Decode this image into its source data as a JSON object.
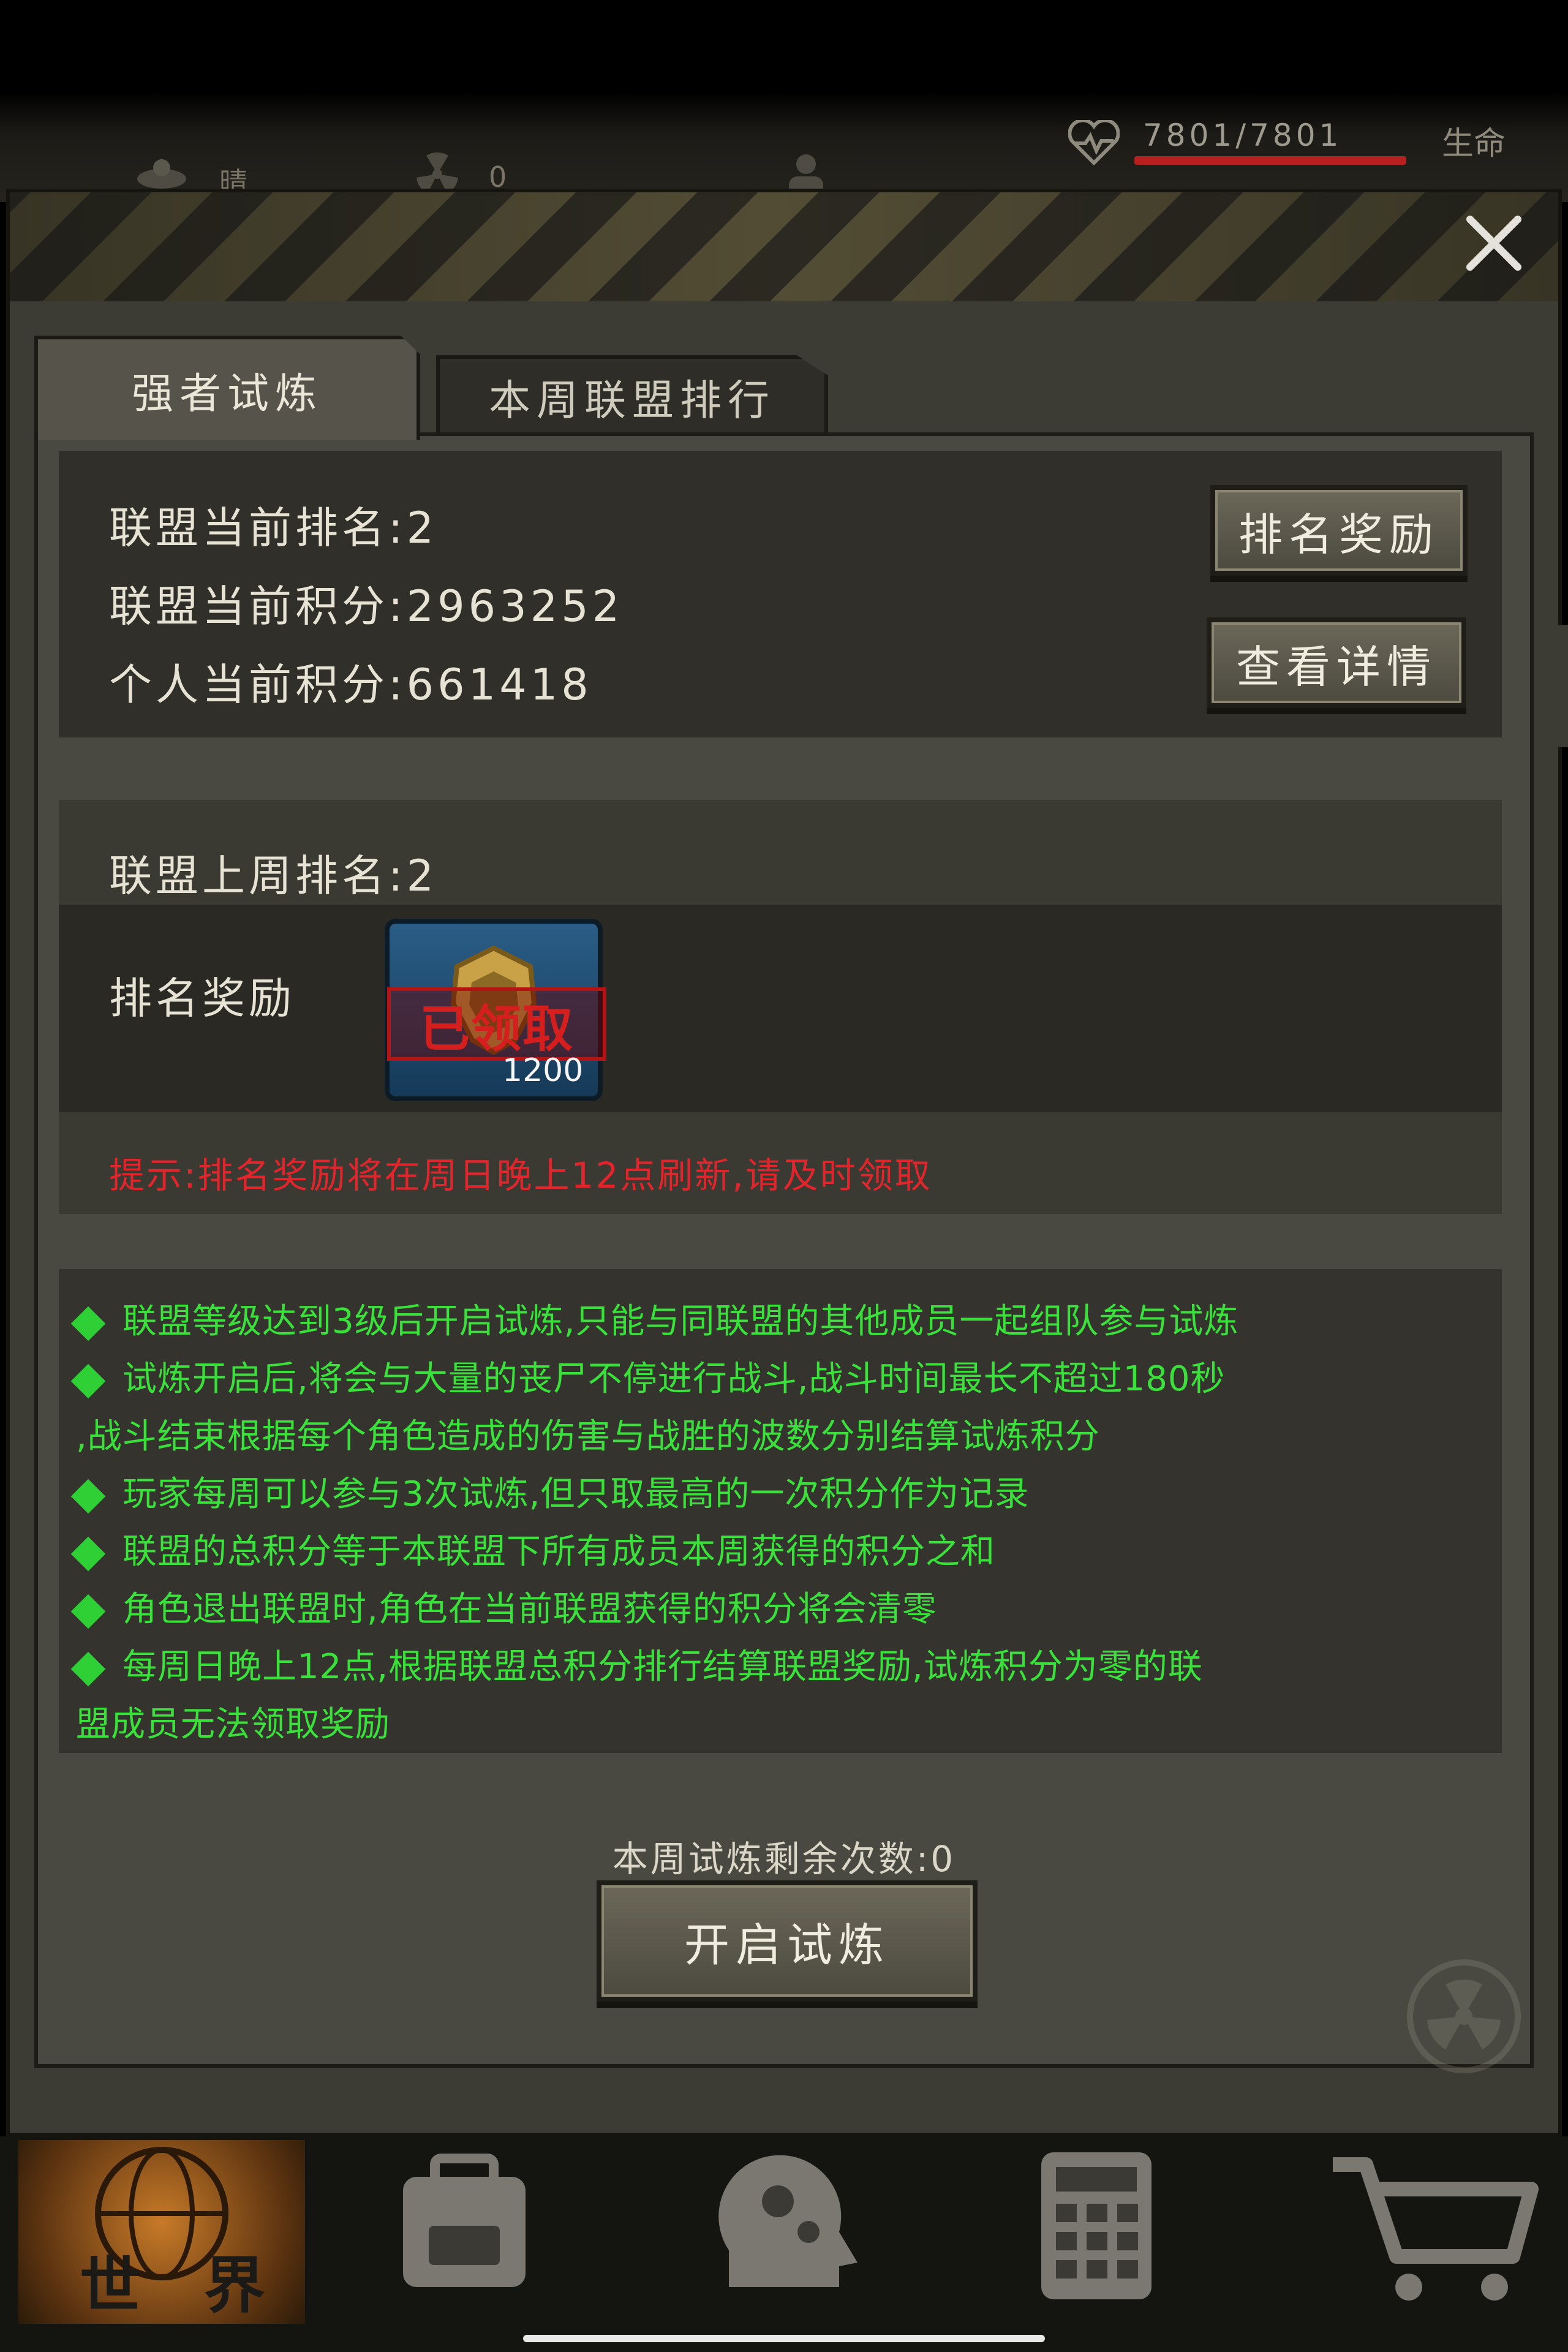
{
  "status_bar": {
    "hp_text": "7801/7801",
    "life_label": "生命",
    "weather_label": "晴",
    "radiation_value": "0"
  },
  "tabs": [
    {
      "label": "强者试炼",
      "active": true
    },
    {
      "label": "本周联盟排行",
      "active": false
    }
  ],
  "current": {
    "alliance_rank": "联盟当前排名:2",
    "alliance_score": "联盟当前积分:2963252",
    "personal_score": "个人当前积分:661418",
    "rank_reward_button": "排名奖励",
    "details_button": "查看详情"
  },
  "last_week": {
    "alliance_rank": "联盟上周排名:2",
    "reward_label": "排名奖励",
    "reward_stamp": "已领取",
    "reward_quantity": "1200",
    "tip": "提示:排名奖励将在周日晚上12点刷新,请及时领取"
  },
  "rules": [
    "联盟等级达到3级后开启试炼,只能与同联盟的其他成员一起组队参与试炼",
    "试炼开启后,将会与大量的丧尸不停进行战斗,战斗时间最长不超过180秒",
    ",战斗结束根据每个角色造成的伤害与战胜的波数分别结算试炼积分",
    "玩家每周可以参与3次试炼,但只取最高的一次积分作为记录",
    "联盟的总积分等于本联盟下所有成员本周获得的积分之和",
    "角色退出联盟时,角色在当前联盟获得的积分将会清零",
    "每周日晚上12点,根据联盟总积分排行结算联盟奖励,试炼积分为零的联",
    "盟成员无法领取奖励"
  ],
  "remaining": "本周试炼剩余次数:0",
  "start_button": "开启试炼",
  "nav": {
    "world_label": "世 界",
    "items": [
      "world-icon",
      "backpack-icon",
      "skills-head-icon",
      "calculator-icon",
      "shop-cart-icon"
    ]
  },
  "colors": {
    "rules_text": "#39e13a",
    "tip_text": "#e0262c",
    "hp_bar": "#b82020",
    "world_active": "#c77a28"
  }
}
